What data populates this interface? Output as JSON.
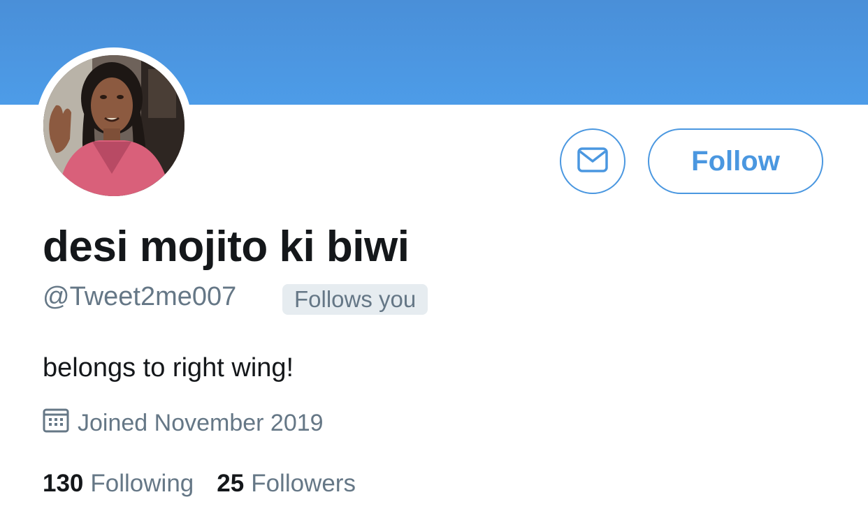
{
  "profile": {
    "display_name": "desi mojito ki biwi",
    "handle": "@Tweet2me007",
    "follows_you_badge": "Follows you",
    "bio": "belongs to right wing!",
    "joined": "Joined November 2019",
    "avatar": "profile-photo"
  },
  "actions": {
    "message_icon": "envelope-icon",
    "follow_label": "Follow"
  },
  "stats": {
    "following_count": "130",
    "following_label": "Following",
    "followers_count": "25",
    "followers_label": "Followers"
  },
  "icons": {
    "joined": "calendar-icon"
  },
  "colors": {
    "banner": "#4d9ce8",
    "accent": "#4a97e0",
    "text_primary": "#14171a",
    "text_secondary": "#657786",
    "badge_bg": "#e6ecf0"
  }
}
